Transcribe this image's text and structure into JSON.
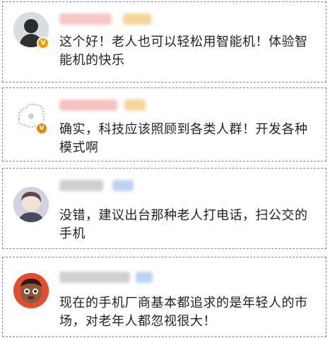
{
  "comments": [
    {
      "text": "这个好！老人也可以轻松用智能机！体验智能机的快乐",
      "verified": true,
      "name_color": "#f7c6c6",
      "tag_color": "#f6d59a"
    },
    {
      "text": "确实，科技应该照顾到各类人群！开发各种模式啊",
      "verified": true,
      "name_color": "#f6c2c2",
      "tag_color": "#f6d59a"
    },
    {
      "text": "没错，建议出台那种老人打电话，扫公交的手机",
      "verified": false,
      "name_color": "#cfcfcf",
      "tag_color": "#b9d4f3"
    },
    {
      "text": "现在的手机厂商基本都追求的是年轻人的市场，对老年人都忽视很大！",
      "verified": false,
      "name_color": "#cfcfcf",
      "tag_color": "#b9d4f3"
    }
  ],
  "badge_symbol": "V"
}
